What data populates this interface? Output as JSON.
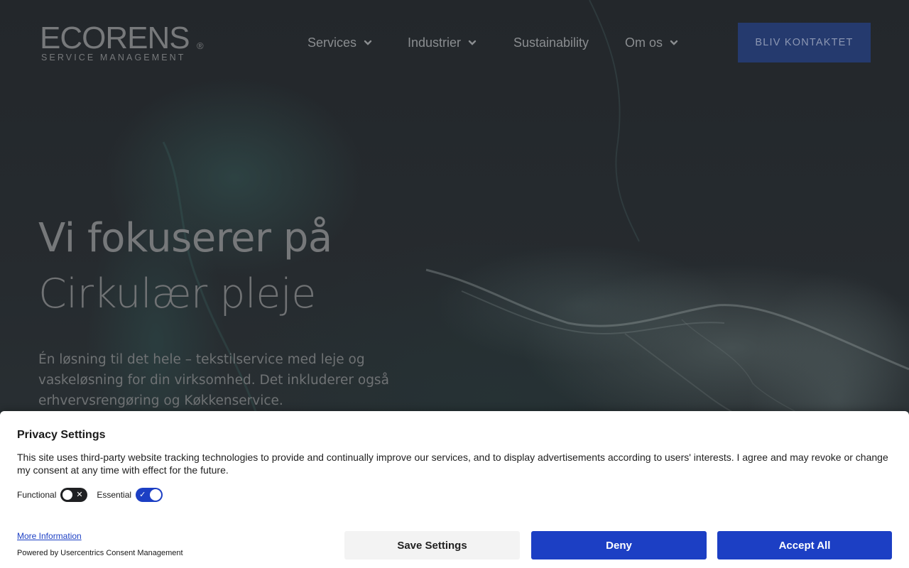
{
  "header": {
    "logo": {
      "name": "ECORENS",
      "registered": "®",
      "tagline": "SERVICE MANAGEMENT"
    },
    "nav": [
      {
        "label": "Services",
        "has_dropdown": true
      },
      {
        "label": "Industrier",
        "has_dropdown": true
      },
      {
        "label": "Sustainability",
        "has_dropdown": false
      },
      {
        "label": "Om os",
        "has_dropdown": true
      }
    ],
    "cta_label": "BLIV KONTAKTET"
  },
  "hero": {
    "title_line1": "Vi fokuserer på",
    "title_line2": "Cirkulær pleje",
    "description": "Én løsning til det hele – tekstilservice med leje og vaskeløsning for din virksomhed. Det inkluderer også erhvervsrengøring og Køkkenservice."
  },
  "consent": {
    "title": "Privacy Settings",
    "text": "This site uses third-party website tracking technologies to provide and continually improve our services, and to display advertisements according to users' interests. I agree and may revoke or change my consent at any time with effect for the future.",
    "toggles": [
      {
        "label": "Functional",
        "state": "off"
      },
      {
        "label": "Essential",
        "state": "on"
      }
    ],
    "more_info": "More Information",
    "powered_by": "Powered by Usercentrics Consent Management",
    "buttons": {
      "save": "Save Settings",
      "deny": "Deny",
      "accept": "Accept All"
    }
  },
  "colors": {
    "background": "#22262a",
    "cta": "#253a6e",
    "consent_primary": "#1c3fc4"
  }
}
